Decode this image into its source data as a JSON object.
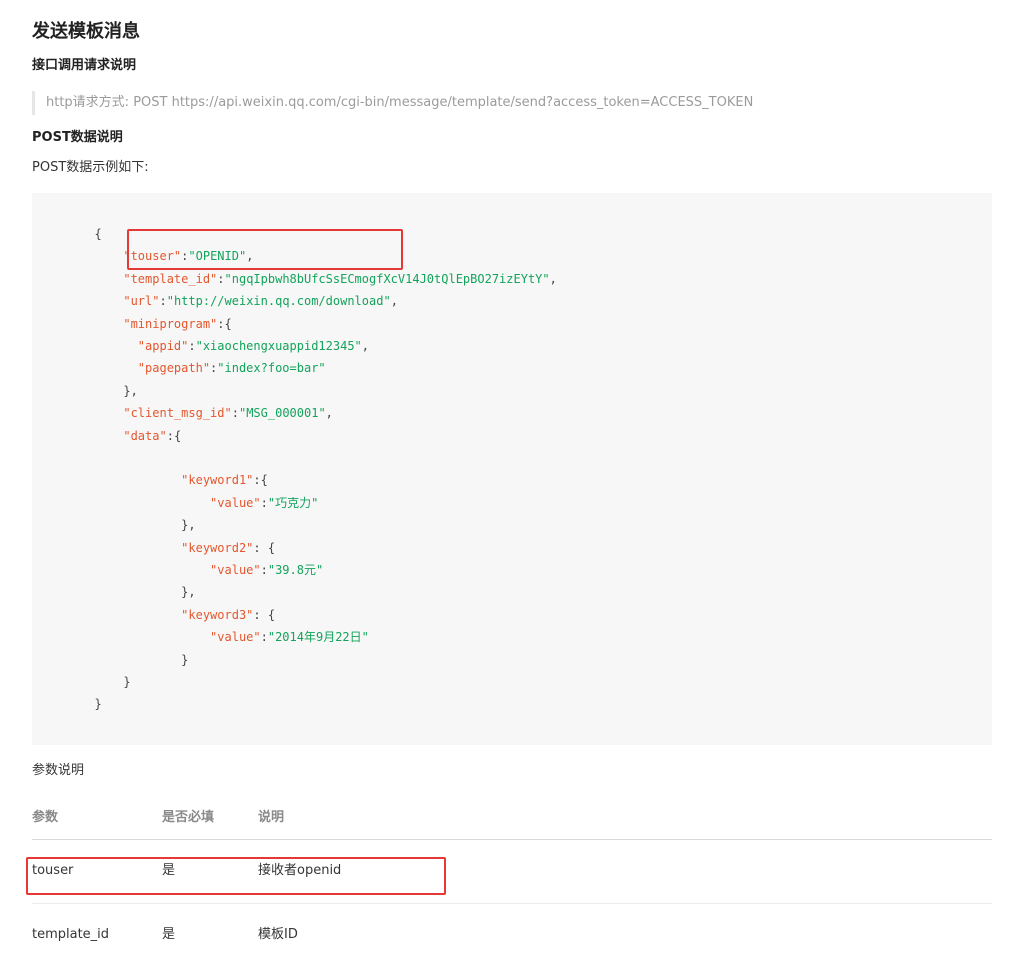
{
  "page": {
    "title": "发送模板消息",
    "api_heading": "接口调用请求说明",
    "api_request": "http请求方式: POST https://api.weixin.qq.com/cgi-bin/message/template/send?access_token=ACCESS_TOKEN",
    "post_heading": "POST数据说明",
    "post_example_text": "POST数据示例如下:",
    "params_heading": "参数说明"
  },
  "code": {
    "lines": [
      {
        "indent": "  ",
        "parts": [
          {
            "t": "p",
            "v": "{"
          }
        ]
      },
      {
        "indent": "      ",
        "parts": [
          {
            "t": "k",
            "v": "\"touser\""
          },
          {
            "t": "p",
            "v": ":"
          },
          {
            "t": "s",
            "v": "\"OPENID\""
          },
          {
            "t": "p",
            "v": ","
          }
        ]
      },
      {
        "indent": "      ",
        "parts": [
          {
            "t": "k",
            "v": "\"template_id\""
          },
          {
            "t": "p",
            "v": ":"
          },
          {
            "t": "s",
            "v": "\"ngqIpbwh8bUfcSsECmogfXcV14J0tQlEpBO27izEYtY\""
          },
          {
            "t": "p",
            "v": ","
          }
        ]
      },
      {
        "indent": "      ",
        "parts": [
          {
            "t": "k",
            "v": "\"url\""
          },
          {
            "t": "p",
            "v": ":"
          },
          {
            "t": "s",
            "v": "\"http://weixin.qq.com/download\""
          },
          {
            "t": "p",
            "v": ","
          }
        ]
      },
      {
        "indent": "      ",
        "parts": [
          {
            "t": "k",
            "v": "\"miniprogram\""
          },
          {
            "t": "p",
            "v": ":{"
          }
        ]
      },
      {
        "indent": "        ",
        "parts": [
          {
            "t": "k",
            "v": "\"appid\""
          },
          {
            "t": "p",
            "v": ":"
          },
          {
            "t": "s",
            "v": "\"xiaochengxuappid12345\""
          },
          {
            "t": "p",
            "v": ","
          }
        ]
      },
      {
        "indent": "        ",
        "parts": [
          {
            "t": "k",
            "v": "\"pagepath\""
          },
          {
            "t": "p",
            "v": ":"
          },
          {
            "t": "s",
            "v": "\"index?foo=bar\""
          }
        ]
      },
      {
        "indent": "      ",
        "parts": [
          {
            "t": "p",
            "v": "},"
          }
        ]
      },
      {
        "indent": "      ",
        "parts": [
          {
            "t": "k",
            "v": "\"client_msg_id\""
          },
          {
            "t": "p",
            "v": ":"
          },
          {
            "t": "s",
            "v": "\"MSG_000001\""
          },
          {
            "t": "p",
            "v": ","
          }
        ]
      },
      {
        "indent": "      ",
        "parts": [
          {
            "t": "k",
            "v": "\"data\""
          },
          {
            "t": "p",
            "v": ":{"
          }
        ]
      },
      {
        "indent": "",
        "parts": []
      },
      {
        "indent": "              ",
        "parts": [
          {
            "t": "k",
            "v": "\"keyword1\""
          },
          {
            "t": "p",
            "v": ":{"
          }
        ]
      },
      {
        "indent": "                  ",
        "parts": [
          {
            "t": "k",
            "v": "\"value\""
          },
          {
            "t": "p",
            "v": ":"
          },
          {
            "t": "s",
            "v": "\"巧克力\""
          }
        ]
      },
      {
        "indent": "              ",
        "parts": [
          {
            "t": "p",
            "v": "},"
          }
        ]
      },
      {
        "indent": "              ",
        "parts": [
          {
            "t": "k",
            "v": "\"keyword2\""
          },
          {
            "t": "p",
            "v": ": {"
          }
        ]
      },
      {
        "indent": "                  ",
        "parts": [
          {
            "t": "k",
            "v": "\"value\""
          },
          {
            "t": "p",
            "v": ":"
          },
          {
            "t": "s",
            "v": "\"39.8元\""
          }
        ]
      },
      {
        "indent": "              ",
        "parts": [
          {
            "t": "p",
            "v": "},"
          }
        ]
      },
      {
        "indent": "              ",
        "parts": [
          {
            "t": "k",
            "v": "\"keyword3\""
          },
          {
            "t": "p",
            "v": ": {"
          }
        ]
      },
      {
        "indent": "                  ",
        "parts": [
          {
            "t": "k",
            "v": "\"value\""
          },
          {
            "t": "p",
            "v": ":"
          },
          {
            "t": "s",
            "v": "\"2014年9月22日\""
          }
        ]
      },
      {
        "indent": "              ",
        "parts": [
          {
            "t": "p",
            "v": "}"
          }
        ]
      },
      {
        "indent": "      ",
        "parts": [
          {
            "t": "p",
            "v": "}"
          }
        ]
      },
      {
        "indent": "  ",
        "parts": [
          {
            "t": "p",
            "v": "}"
          }
        ]
      }
    ]
  },
  "table": {
    "headers": [
      "参数",
      "是否必填",
      "说明"
    ],
    "rows": [
      {
        "param": "touser",
        "required": "是",
        "desc": "接收者openid"
      },
      {
        "param": "template_id",
        "required": "是",
        "desc": "模板ID"
      }
    ]
  },
  "colors": {
    "key": "#e4572e",
    "string": "#13a35b",
    "highlight_box": "#e53935",
    "code_background": "#f7f7f7"
  }
}
